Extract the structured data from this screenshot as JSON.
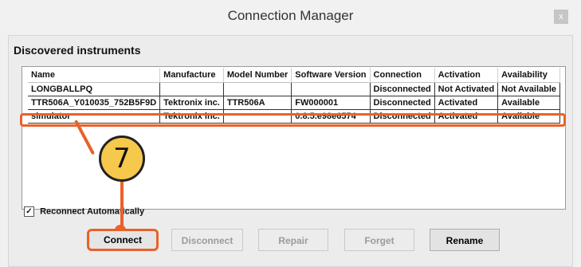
{
  "window": {
    "title": "Connection Manager",
    "close_label": "x"
  },
  "section": {
    "title": "Discovered instruments"
  },
  "table": {
    "headers": [
      "Name",
      "Manufacture",
      "Model Number",
      "Software Version",
      "Connection",
      "Activation",
      "Availability"
    ],
    "rows": [
      [
        "LONGBALLPQ",
        "",
        "",
        "",
        "Disconnected",
        "Not Activated",
        "Not Available"
      ],
      [
        "TTR506A_Y010035_752B5F9D",
        "Tektronix inc.",
        "TTR506A",
        "FW000001",
        "Disconnected",
        "Activated",
        "Available"
      ],
      [
        "simulator",
        "Tektronix inc.",
        "",
        "0.8.5.e98e6574",
        "Disconnected",
        "Activated",
        "Available"
      ]
    ]
  },
  "callout": {
    "number": "7",
    "color": "#e8622a",
    "fill": "#f6c84c"
  },
  "reconnect": {
    "label": "Reconnect Automatically",
    "checked_glyph": "✓"
  },
  "buttons": {
    "connect": "Connect",
    "disconnect": "Disconnect",
    "repair": "Repair",
    "forget": "Forget",
    "rename": "Rename"
  }
}
